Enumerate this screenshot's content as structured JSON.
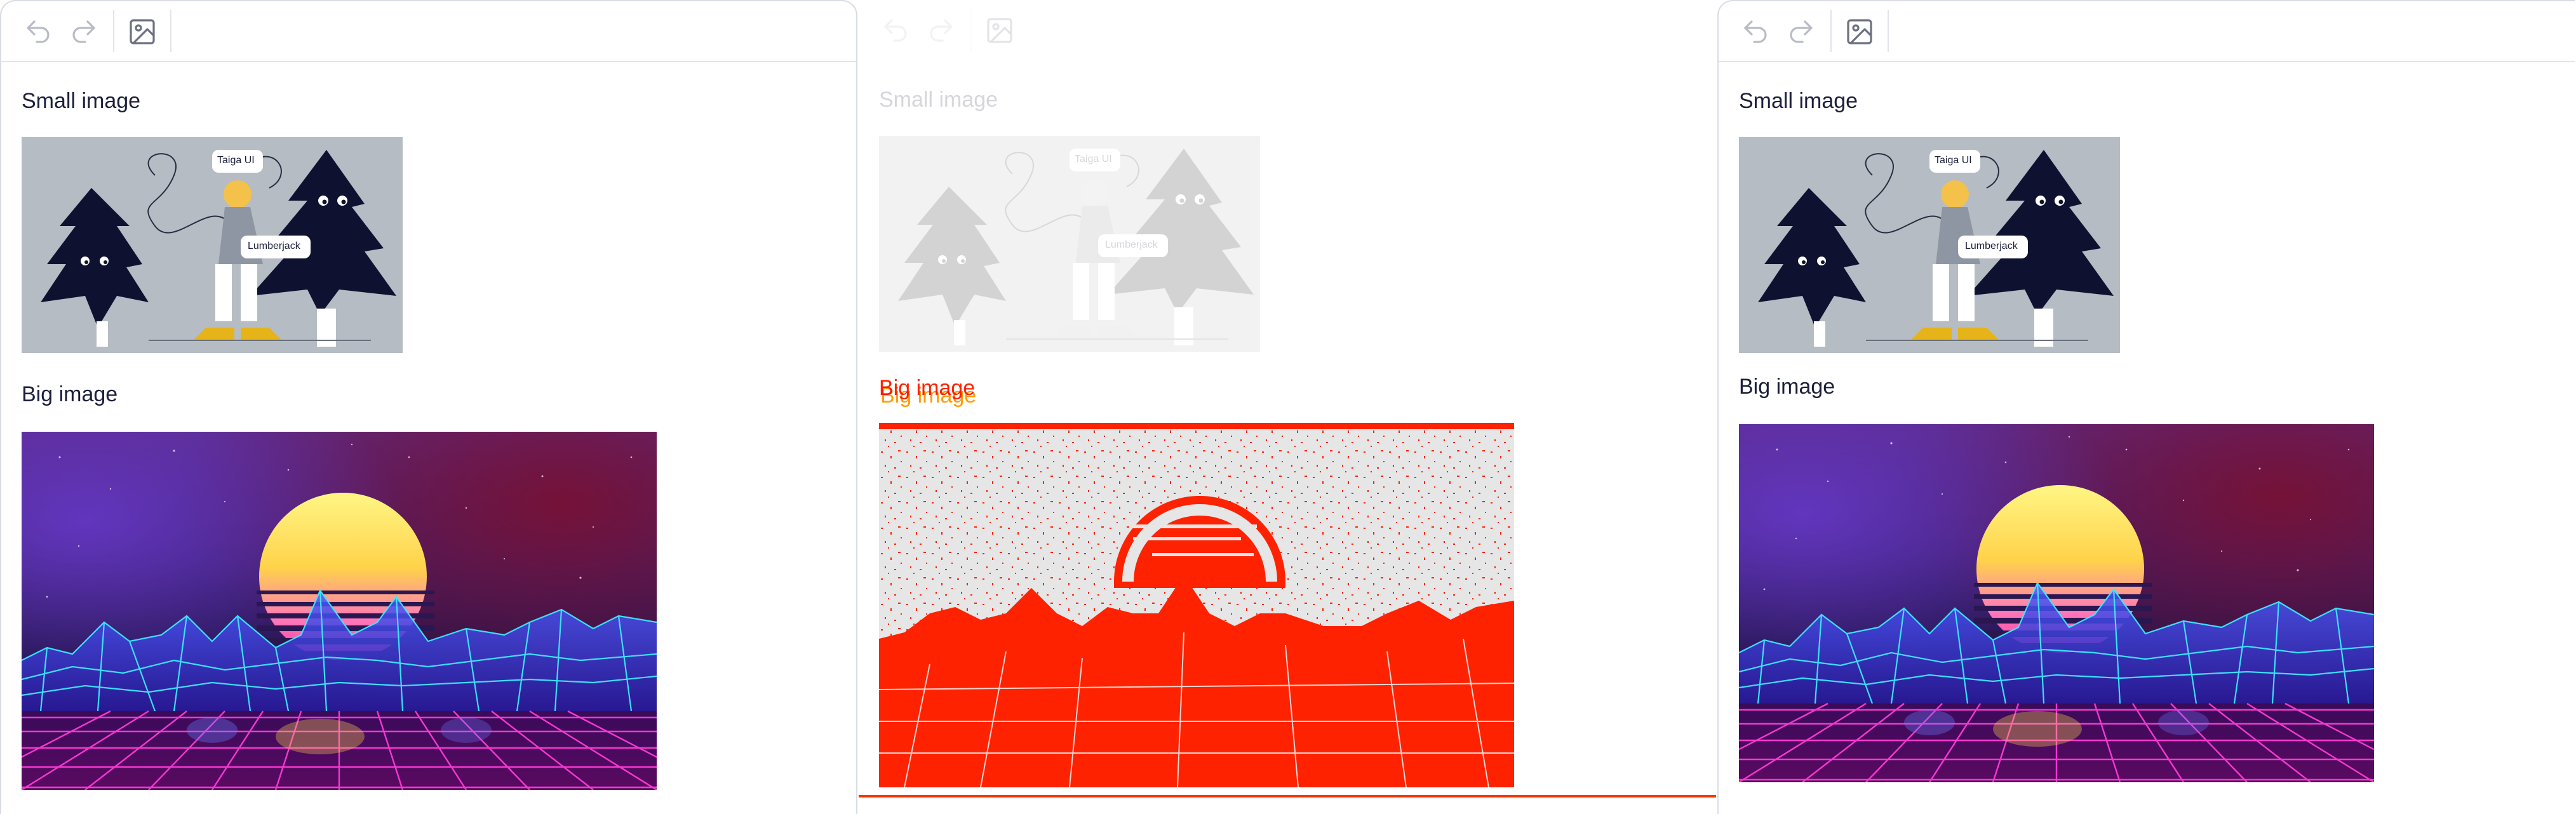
{
  "panels": [
    {
      "id": "reference",
      "toolbar": {
        "undo_icon": "undo-icon",
        "redo_icon": "redo-icon",
        "image_icon": "image-icon"
      },
      "small_label": "Small image",
      "small_image": {
        "bubble1": "Taiga UI",
        "bubble2": "Lumberjack"
      },
      "big_label": "Big image"
    },
    {
      "id": "diff",
      "toolbar": {
        "undo_icon": "undo-icon",
        "redo_icon": "redo-icon",
        "image_icon": "image-icon"
      },
      "small_label": "Small image",
      "small_image": {
        "bubble1": "Taiga UI",
        "bubble2": "Lumberjack"
      },
      "big_label": "Big image",
      "big_label_overlay": "Big image"
    },
    {
      "id": "actual",
      "toolbar": {
        "undo_icon": "undo-icon",
        "redo_icon": "redo-icon",
        "image_icon": "image-icon"
      },
      "small_label": "Small image",
      "small_image": {
        "bubble1": "Taiga UI",
        "bubble2": "Lumberjack"
      },
      "big_label": "Big image"
    }
  ],
  "colors": {
    "diff_red": "#ff2200",
    "diff_orange": "#ff9b00",
    "small_bg": "#b3bac2",
    "tree": "#0e1230",
    "sun_top": "#fff275",
    "sun_bottom": "#ff4aa8",
    "grid_cyan": "#3ee8ff",
    "grid_magenta": "#ff3ad8"
  }
}
